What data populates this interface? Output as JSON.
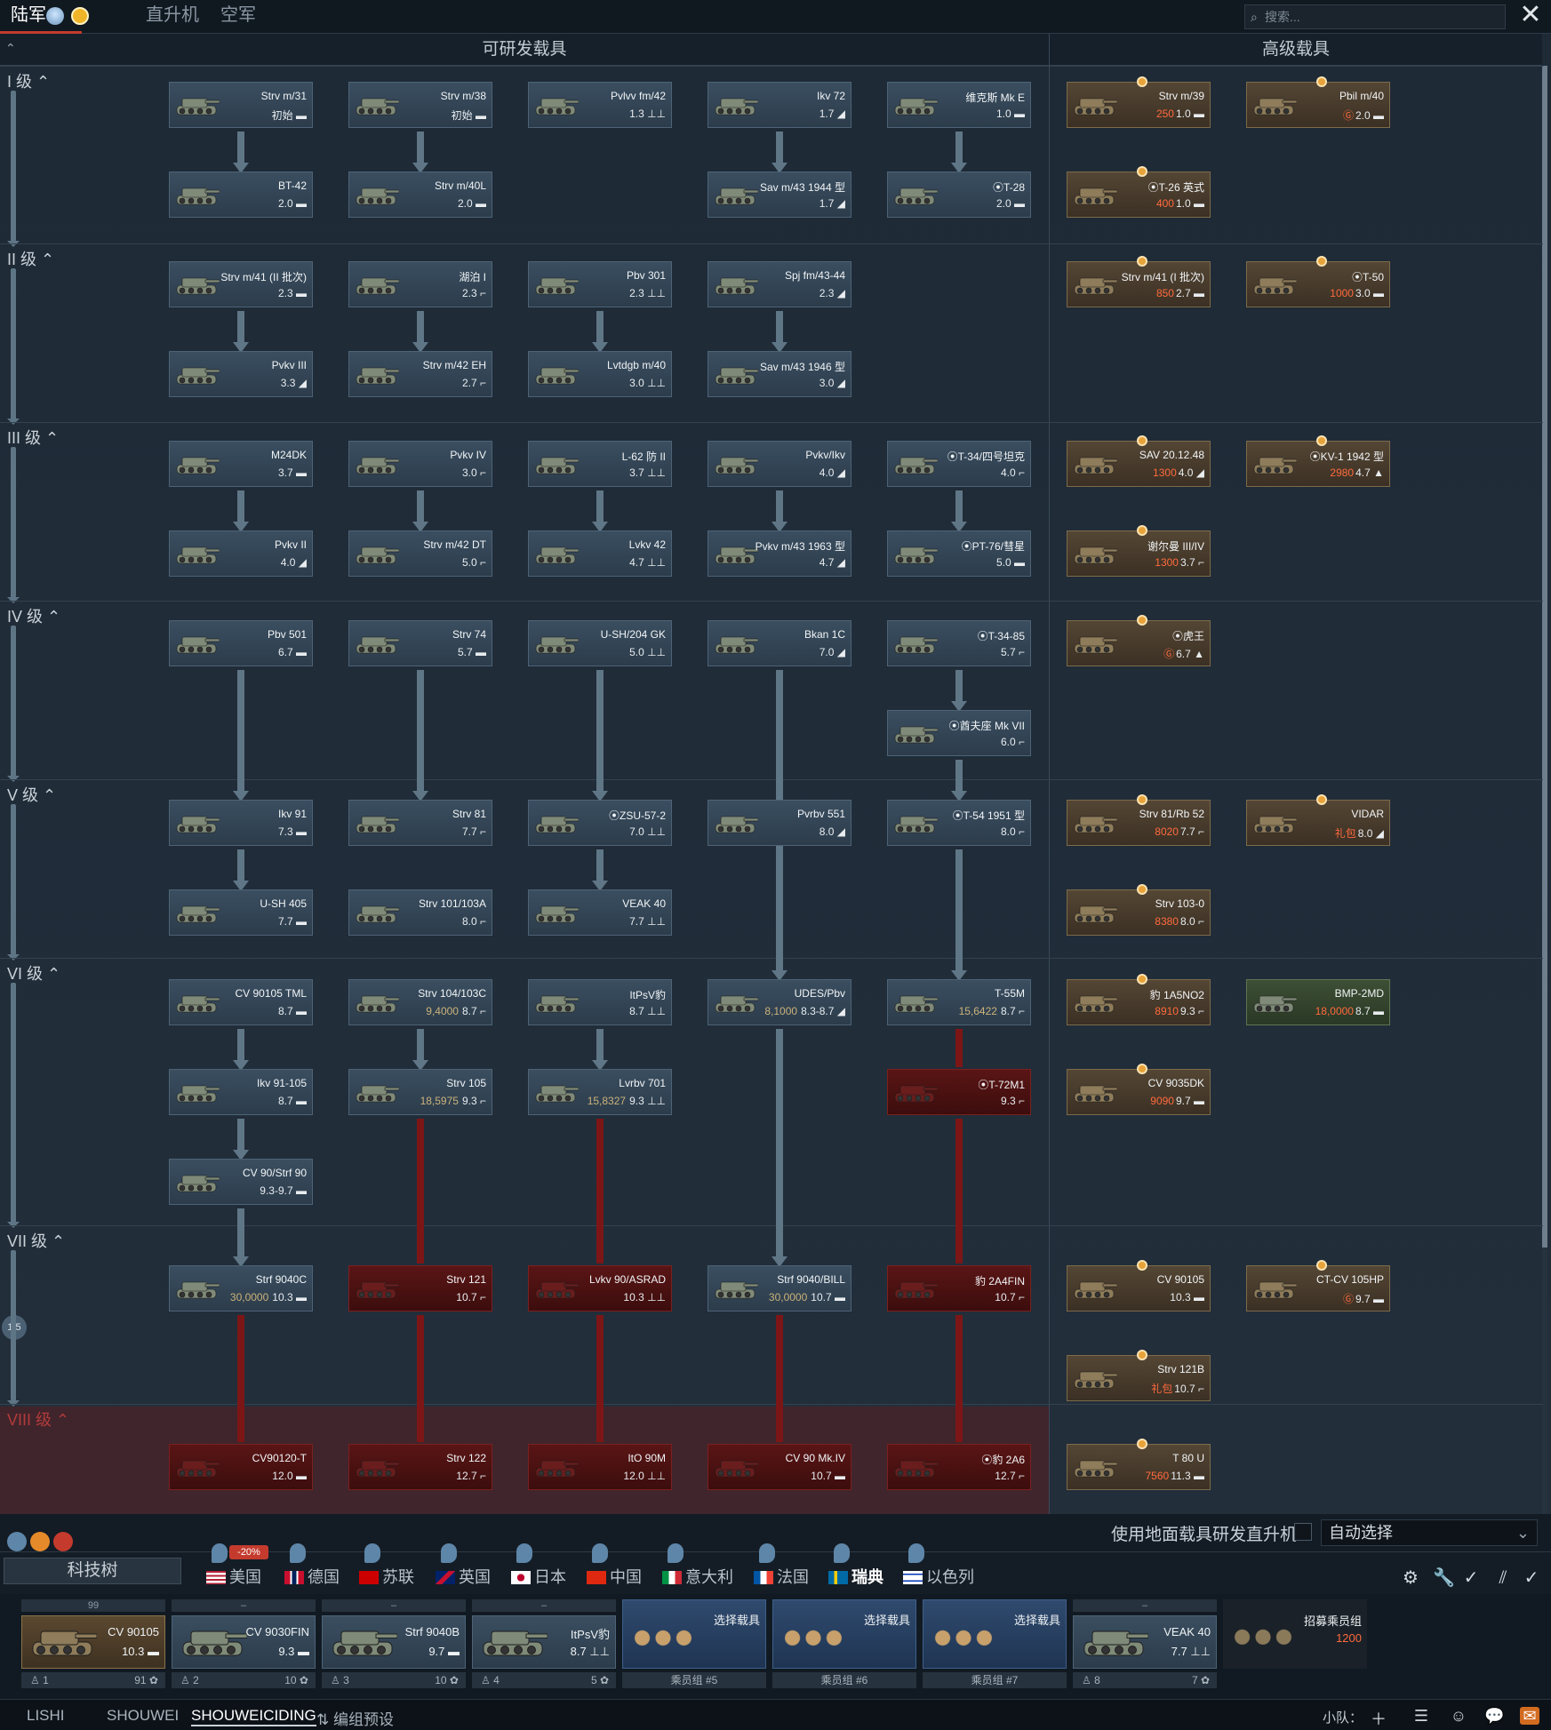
{
  "top": {
    "tabs": [
      "陆军",
      "直升机",
      "空军"
    ],
    "search_placeholder": "搜索..."
  },
  "tree": {
    "col_research": "可研发载具",
    "col_premium": "高级载具",
    "ranks": [
      "I 级",
      "II 级",
      "III 级",
      "IV 级",
      "V 级",
      "VI 级",
      "VII 级",
      "VIII 级"
    ],
    "progress_badge": "1/5"
  },
  "vehicles": [
    {
      "name": "Strv m/31",
      "br": "初始 ▬"
    },
    {
      "name": "Strv m/38",
      "br": "初始 ▬"
    },
    {
      "name": "Pvlvv fm/42",
      "br": "1.3 ⊥⊥"
    },
    {
      "name": "Ikv 72",
      "br": "1.7 ◢"
    },
    {
      "name": "维克斯 Mk E",
      "br": "1.0 ▬"
    },
    {
      "name": "BT-42",
      "br": "2.0 ▬"
    },
    {
      "name": "Strv m/40L",
      "br": "2.0 ▬"
    },
    {
      "name": "Sav m/43 1944 型",
      "br": "1.7 ◢"
    },
    {
      "name": "⦿T-28",
      "br": "2.0 ▬"
    },
    {
      "name": "Strv m/41 (II 批次)",
      "br": "2.3 ▬"
    },
    {
      "name": "湖泊 I",
      "br": "2.3 ⌐"
    },
    {
      "name": "Pbv 301",
      "br": "2.3 ⊥⊥"
    },
    {
      "name": "Spj fm/43-44",
      "br": "2.3 ◢"
    },
    {
      "name": "Pvkv III",
      "br": "3.3 ◢"
    },
    {
      "name": "Strv m/42 EH",
      "br": "2.7 ⌐"
    },
    {
      "name": "Lvtdgb m/40",
      "br": "3.0 ⊥⊥"
    },
    {
      "name": "Sav m/43 1946 型",
      "br": "3.0 ◢"
    },
    {
      "name": "M24DK",
      "br": "3.7 ▬"
    },
    {
      "name": "Pvkv IV",
      "br": "3.0 ⌐"
    },
    {
      "name": "L-62 防 II",
      "br": "3.7 ⊥⊥"
    },
    {
      "name": "Pvkv/Ikv",
      "br": "4.0 ◢"
    },
    {
      "name": "⦿T-34/四号坦克",
      "br": "4.0 ⌐"
    },
    {
      "name": "Pvkv II",
      "br": "4.0 ◢"
    },
    {
      "name": "Strv m/42 DT",
      "br": "5.0 ⌐"
    },
    {
      "name": "Lvkv 42",
      "br": "4.7 ⊥⊥"
    },
    {
      "name": "Pvkv m/43 1963 型",
      "br": "4.7 ◢"
    },
    {
      "name": "⦿PT-76/彗星",
      "br": "5.0 ▬"
    },
    {
      "name": "Pbv 501",
      "br": "6.7 ▬"
    },
    {
      "name": "Strv 74",
      "br": "5.7 ▬"
    },
    {
      "name": "U-SH/204 GK",
      "br": "5.0 ⊥⊥"
    },
    {
      "name": "Bkan 1C",
      "br": "7.0 ◢"
    },
    {
      "name": "⦿T-34-85",
      "br": "5.7 ⌐"
    },
    {
      "name": "⦿酋夫座 Mk VII",
      "br": "6.0 ⌐"
    },
    {
      "name": "Ikv 91",
      "br": "7.3 ▬"
    },
    {
      "name": "Strv 81",
      "br": "7.7 ⌐"
    },
    {
      "name": "⦿ZSU-57-2",
      "br": "7.0 ⊥⊥"
    },
    {
      "name": "Pvrbv 551",
      "br": "8.0 ◢"
    },
    {
      "name": "⦿T-54 1951 型",
      "br": "8.0 ⌐"
    },
    {
      "name": "U-SH 405",
      "br": "7.7 ▬"
    },
    {
      "name": "Strv 101/103A",
      "br": "8.0 ⌐"
    },
    {
      "name": "VEAK 40",
      "br": "7.7 ⊥⊥"
    },
    {
      "name": "CV 90105 TML",
      "br": "8.7 ▬"
    },
    {
      "name": "Strv 104/103C",
      "rp": "9,4000",
      "br": "8.7 ⌐"
    },
    {
      "name": "ItPsV豹",
      "br": "8.7 ⊥⊥"
    },
    {
      "name": "UDES/Pbv",
      "rp": "8,1000",
      "br": "8.3-8.7 ◢"
    },
    {
      "name": "T-55M",
      "rp": "15,6422",
      "br": "8.7 ⌐"
    },
    {
      "name": "Ikv 91-105",
      "br": "8.7 ▬"
    },
    {
      "name": "Strv 105",
      "rp": "18,5975",
      "br": "9.3 ⌐"
    },
    {
      "name": "Lvrbv 701",
      "rp": "15,8327",
      "br": "9.3 ⊥⊥"
    },
    {
      "name": "⦿T-72M1",
      "br": "9.3 ⌐"
    },
    {
      "name": "CV 90/Strf 90",
      "br": "9.3-9.7 ▬"
    },
    {
      "name": "Strf 9040C",
      "rp": "30,0000",
      "br": "10.3 ▬"
    },
    {
      "name": "Strv 121",
      "br": "10.7 ⌐"
    },
    {
      "name": "Lvkv 90/ASRAD",
      "br": "10.3 ⊥⊥"
    },
    {
      "name": "Strf 9040/BILL",
      "rp": "30,0000",
      "br": "10.7 ▬"
    },
    {
      "name": "豹 2A4FIN",
      "br": "10.7 ⌐"
    },
    {
      "name": "CV90120-T",
      "br": "12.0 ▬"
    },
    {
      "name": "Strv 122",
      "br": "12.7 ⌐"
    },
    {
      "name": "ItO 90M",
      "br": "12.0 ⊥⊥"
    },
    {
      "name": "CV 90 Mk.IV",
      "br": "10.7 ▬"
    },
    {
      "name": "⦿豹 2A6",
      "br": "12.7 ⌐"
    }
  ],
  "premium": [
    {
      "name": "Strv m/39",
      "price": "250",
      "br": "1.0 ▬"
    },
    {
      "name": "Pbil m/40",
      "price": "Ⓖ",
      "br": "2.0 ▬"
    },
    {
      "name": "⦿T-26 英式",
      "price": "400",
      "br": "1.0 ▬"
    },
    {
      "name": "Strv m/41 (I 批次)",
      "price": "850",
      "br": "2.7 ▬"
    },
    {
      "name": "⦿T-50",
      "price": "1000",
      "br": "3.0 ▬"
    },
    {
      "name": "SAV 20.12.48",
      "price": "1300",
      "br": "4.0 ◢"
    },
    {
      "name": "⦿KV-1 1942 型",
      "price": "2980",
      "br": "4.7 ▲"
    },
    {
      "name": "谢尔曼 III/IV",
      "price": "1300",
      "br": "3.7 ⌐"
    },
    {
      "name": "⦿虎王",
      "price": "Ⓖ",
      "br": "6.7 ▲"
    },
    {
      "name": "Strv 81/Rb 52",
      "price": "8020",
      "br": "7.7 ⌐"
    },
    {
      "name": "VIDAR",
      "price": "礼包",
      "br": "8.0 ◢"
    },
    {
      "name": "Strv 103-0",
      "price": "8380",
      "br": "8.0 ⌐"
    },
    {
      "name": "豹 1A5NO2",
      "price": "8910",
      "br": "9.3 ⌐"
    },
    {
      "name": "BMP-2MD",
      "price": "18,0000",
      "br": "8.7 ▬"
    },
    {
      "name": "CV 9035DK",
      "price": "9090",
      "br": "9.7 ▬"
    },
    {
      "name": "CV 90105",
      "price": "",
      "br": "10.3 ▬"
    },
    {
      "name": "CT-CV 105HP",
      "price": "Ⓖ",
      "br": "9.7 ▬"
    },
    {
      "name": "Strv 121B",
      "price": "礼包",
      "br": "10.7 ⌐"
    },
    {
      "name": "T 80 U",
      "price": "7560",
      "br": "11.3 ▬"
    }
  ],
  "controls": {
    "heli_label": "使用地面载具研发直升机",
    "auto_select": "自动选择"
  },
  "nations": {
    "techtree": "科技树",
    "discount": "-20%",
    "list": [
      "美国",
      "德国",
      "苏联",
      "英国",
      "日本",
      "中国",
      "意大利",
      "法国",
      "瑞典",
      "以色列"
    ]
  },
  "crew": [
    {
      "top": "99",
      "name": "CV 90105",
      "br": "10.3 ▬",
      "idx": "1",
      "num": "91"
    },
    {
      "top": "–",
      "name": "CV 9030FIN",
      "br": "9.3 ▬",
      "idx": "2",
      "num": "10"
    },
    {
      "top": "–",
      "name": "Strf 9040B",
      "br": "9.7 ▬",
      "idx": "3",
      "num": "10"
    },
    {
      "top": "–",
      "name": "ItPsV豹",
      "br": "8.7 ⊥⊥",
      "idx": "4",
      "num": "5"
    },
    {
      "label": "选择载具",
      "group": "乘员组 #5"
    },
    {
      "label": "选择载具",
      "group": "乘员组 #6"
    },
    {
      "label": "选择载具",
      "group": "乘员组 #7"
    },
    {
      "top": "–",
      "name": "VEAK 40",
      "br": "7.7 ⊥⊥",
      "idx": "8",
      "num": "7"
    },
    {
      "label": "招募乘员组",
      "price": "1200"
    }
  ],
  "bottom": {
    "tabs": [
      "LISHI",
      "SHOUWEI",
      "SHOUWEICIDING"
    ],
    "presets": "编组预设",
    "squad": "小队："
  }
}
